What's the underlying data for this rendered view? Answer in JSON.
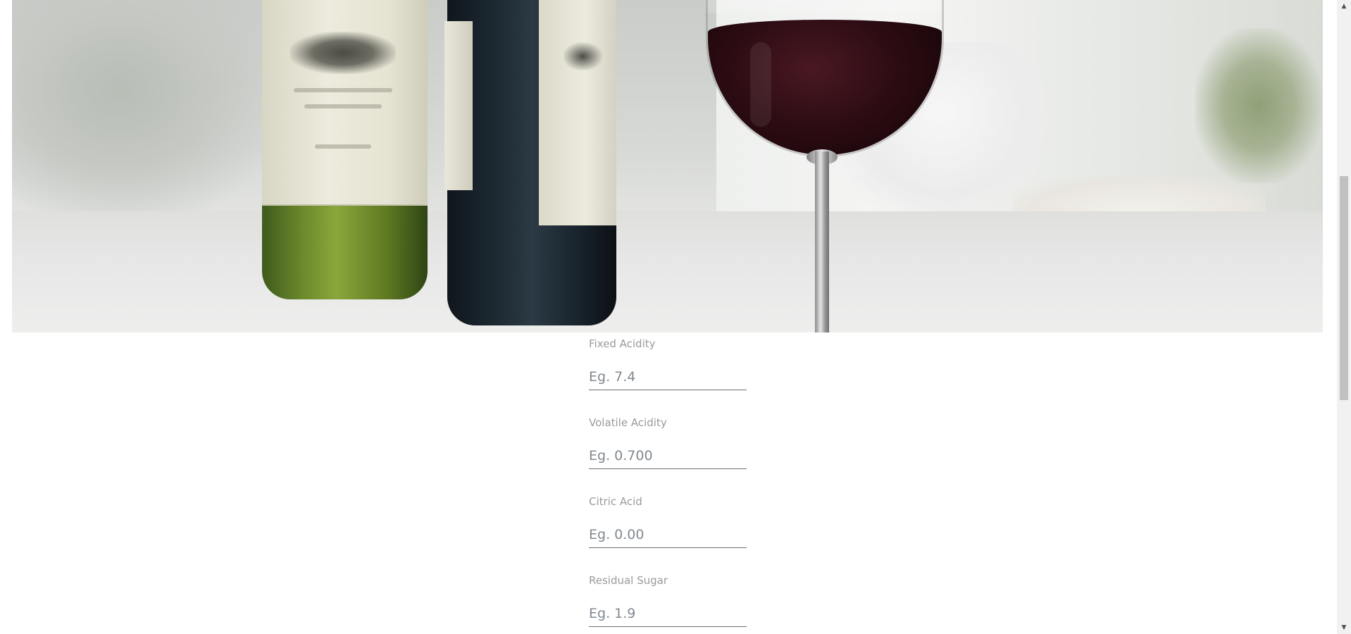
{
  "hero": {
    "image": "wine-bottles-and-glass-photo"
  },
  "form": {
    "fields": [
      {
        "label": "Fixed Acidity",
        "placeholder": "Eg. 7.4",
        "value": ""
      },
      {
        "label": "Volatile Acidity",
        "placeholder": "Eg. 0.700",
        "value": ""
      },
      {
        "label": "Citric Acid",
        "placeholder": "Eg. 0.00",
        "value": ""
      },
      {
        "label": "Residual Sugar",
        "placeholder": "Eg. 1.9",
        "value": ""
      }
    ]
  },
  "scrollbar": {
    "up_icon": "scroll-up-arrow-icon",
    "down_icon": "scroll-down-arrow-icon",
    "up_glyph": "▲",
    "down_glyph": "▼"
  },
  "colors": {
    "label": "#9a9a9a",
    "placeholder": "#6c757d",
    "underline": "#6f6f6f",
    "background": "#ffffff"
  }
}
